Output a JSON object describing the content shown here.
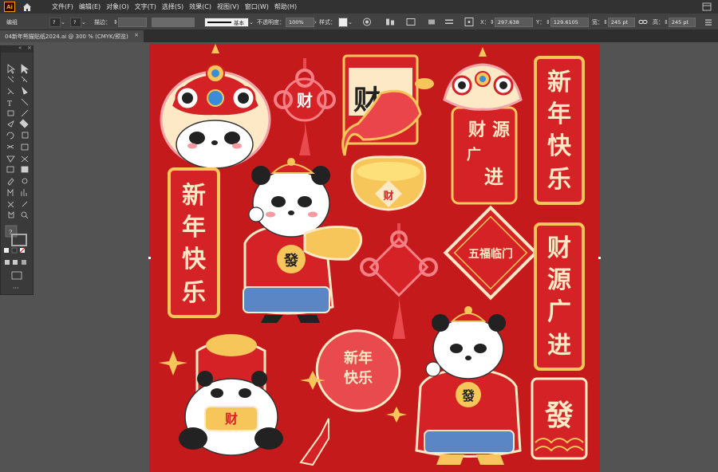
{
  "app": {
    "logo": "Ai",
    "home_icon": "home-icon"
  },
  "menu": [
    "文件(F)",
    "编辑(E)",
    "对象(O)",
    "文字(T)",
    "选择(S)",
    "效果(C)",
    "视图(V)",
    "窗口(W)",
    "帮助(H)"
  ],
  "control": {
    "group_label": "编组",
    "stroke_label": "描边：",
    "brush_label": "基本",
    "opacity_label": "不透明度：",
    "opacity_value": "100%",
    "style_label": "样式：",
    "x_label": "X：",
    "x_value": "297.638",
    "y_label": "Y：",
    "y_value": "129.6105",
    "w_label": "宽：",
    "w_value": "245 pt",
    "h_label": "高：",
    "h_value": "245 pt"
  },
  "document_tab": {
    "title": "04新年熊猫贴纸2024.ai @ 300 % (CMYK/预览)",
    "close": "×"
  },
  "artwork": {
    "background": "#c41a1c",
    "couplet_1": [
      "新",
      "年",
      "快",
      "乐"
    ],
    "couplet_2": [
      "新",
      "年",
      "快",
      "乐"
    ],
    "couplet_3": [
      "财",
      "源",
      "广",
      "进"
    ],
    "tag_1": [
      "财",
      "源",
      "广",
      "进"
    ],
    "char_cai": "财",
    "char_fa": "發",
    "diamond_text": "五福临门",
    "lantern_text": "新年快乐"
  },
  "colors": {
    "red": "#d42226",
    "gold": "#f7c65a",
    "cream": "#fde9c6",
    "dark": "#2b2b2b"
  }
}
